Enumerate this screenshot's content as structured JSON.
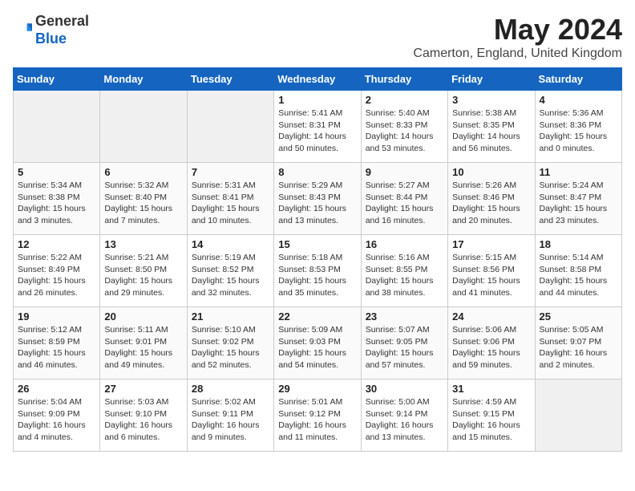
{
  "header": {
    "logo_general": "General",
    "logo_blue": "Blue",
    "month_title": "May 2024",
    "location": "Camerton, England, United Kingdom"
  },
  "weekdays": [
    "Sunday",
    "Monday",
    "Tuesday",
    "Wednesday",
    "Thursday",
    "Friday",
    "Saturday"
  ],
  "weeks": [
    [
      {
        "day": "",
        "empty": true
      },
      {
        "day": "",
        "empty": true
      },
      {
        "day": "",
        "empty": true
      },
      {
        "day": "1",
        "sunrise": "5:41 AM",
        "sunset": "8:31 PM",
        "daylight": "14 hours and 50 minutes."
      },
      {
        "day": "2",
        "sunrise": "5:40 AM",
        "sunset": "8:33 PM",
        "daylight": "14 hours and 53 minutes."
      },
      {
        "day": "3",
        "sunrise": "5:38 AM",
        "sunset": "8:35 PM",
        "daylight": "14 hours and 56 minutes."
      },
      {
        "day": "4",
        "sunrise": "5:36 AM",
        "sunset": "8:36 PM",
        "daylight": "15 hours and 0 minutes."
      }
    ],
    [
      {
        "day": "5",
        "sunrise": "5:34 AM",
        "sunset": "8:38 PM",
        "daylight": "15 hours and 3 minutes."
      },
      {
        "day": "6",
        "sunrise": "5:32 AM",
        "sunset": "8:40 PM",
        "daylight": "15 hours and 7 minutes."
      },
      {
        "day": "7",
        "sunrise": "5:31 AM",
        "sunset": "8:41 PM",
        "daylight": "15 hours and 10 minutes."
      },
      {
        "day": "8",
        "sunrise": "5:29 AM",
        "sunset": "8:43 PM",
        "daylight": "15 hours and 13 minutes."
      },
      {
        "day": "9",
        "sunrise": "5:27 AM",
        "sunset": "8:44 PM",
        "daylight": "15 hours and 16 minutes."
      },
      {
        "day": "10",
        "sunrise": "5:26 AM",
        "sunset": "8:46 PM",
        "daylight": "15 hours and 20 minutes."
      },
      {
        "day": "11",
        "sunrise": "5:24 AM",
        "sunset": "8:47 PM",
        "daylight": "15 hours and 23 minutes."
      }
    ],
    [
      {
        "day": "12",
        "sunrise": "5:22 AM",
        "sunset": "8:49 PM",
        "daylight": "15 hours and 26 minutes."
      },
      {
        "day": "13",
        "sunrise": "5:21 AM",
        "sunset": "8:50 PM",
        "daylight": "15 hours and 29 minutes."
      },
      {
        "day": "14",
        "sunrise": "5:19 AM",
        "sunset": "8:52 PM",
        "daylight": "15 hours and 32 minutes."
      },
      {
        "day": "15",
        "sunrise": "5:18 AM",
        "sunset": "8:53 PM",
        "daylight": "15 hours and 35 minutes."
      },
      {
        "day": "16",
        "sunrise": "5:16 AM",
        "sunset": "8:55 PM",
        "daylight": "15 hours and 38 minutes."
      },
      {
        "day": "17",
        "sunrise": "5:15 AM",
        "sunset": "8:56 PM",
        "daylight": "15 hours and 41 minutes."
      },
      {
        "day": "18",
        "sunrise": "5:14 AM",
        "sunset": "8:58 PM",
        "daylight": "15 hours and 44 minutes."
      }
    ],
    [
      {
        "day": "19",
        "sunrise": "5:12 AM",
        "sunset": "8:59 PM",
        "daylight": "15 hours and 46 minutes."
      },
      {
        "day": "20",
        "sunrise": "5:11 AM",
        "sunset": "9:01 PM",
        "daylight": "15 hours and 49 minutes."
      },
      {
        "day": "21",
        "sunrise": "5:10 AM",
        "sunset": "9:02 PM",
        "daylight": "15 hours and 52 minutes."
      },
      {
        "day": "22",
        "sunrise": "5:09 AM",
        "sunset": "9:03 PM",
        "daylight": "15 hours and 54 minutes."
      },
      {
        "day": "23",
        "sunrise": "5:07 AM",
        "sunset": "9:05 PM",
        "daylight": "15 hours and 57 minutes."
      },
      {
        "day": "24",
        "sunrise": "5:06 AM",
        "sunset": "9:06 PM",
        "daylight": "15 hours and 59 minutes."
      },
      {
        "day": "25",
        "sunrise": "5:05 AM",
        "sunset": "9:07 PM",
        "daylight": "16 hours and 2 minutes."
      }
    ],
    [
      {
        "day": "26",
        "sunrise": "5:04 AM",
        "sunset": "9:09 PM",
        "daylight": "16 hours and 4 minutes."
      },
      {
        "day": "27",
        "sunrise": "5:03 AM",
        "sunset": "9:10 PM",
        "daylight": "16 hours and 6 minutes."
      },
      {
        "day": "28",
        "sunrise": "5:02 AM",
        "sunset": "9:11 PM",
        "daylight": "16 hours and 9 minutes."
      },
      {
        "day": "29",
        "sunrise": "5:01 AM",
        "sunset": "9:12 PM",
        "daylight": "16 hours and 11 minutes."
      },
      {
        "day": "30",
        "sunrise": "5:00 AM",
        "sunset": "9:14 PM",
        "daylight": "16 hours and 13 minutes."
      },
      {
        "day": "31",
        "sunrise": "4:59 AM",
        "sunset": "9:15 PM",
        "daylight": "16 hours and 15 minutes."
      },
      {
        "day": "",
        "empty": true
      }
    ]
  ],
  "labels": {
    "sunrise": "Sunrise:",
    "sunset": "Sunset:",
    "daylight": "Daylight:"
  }
}
